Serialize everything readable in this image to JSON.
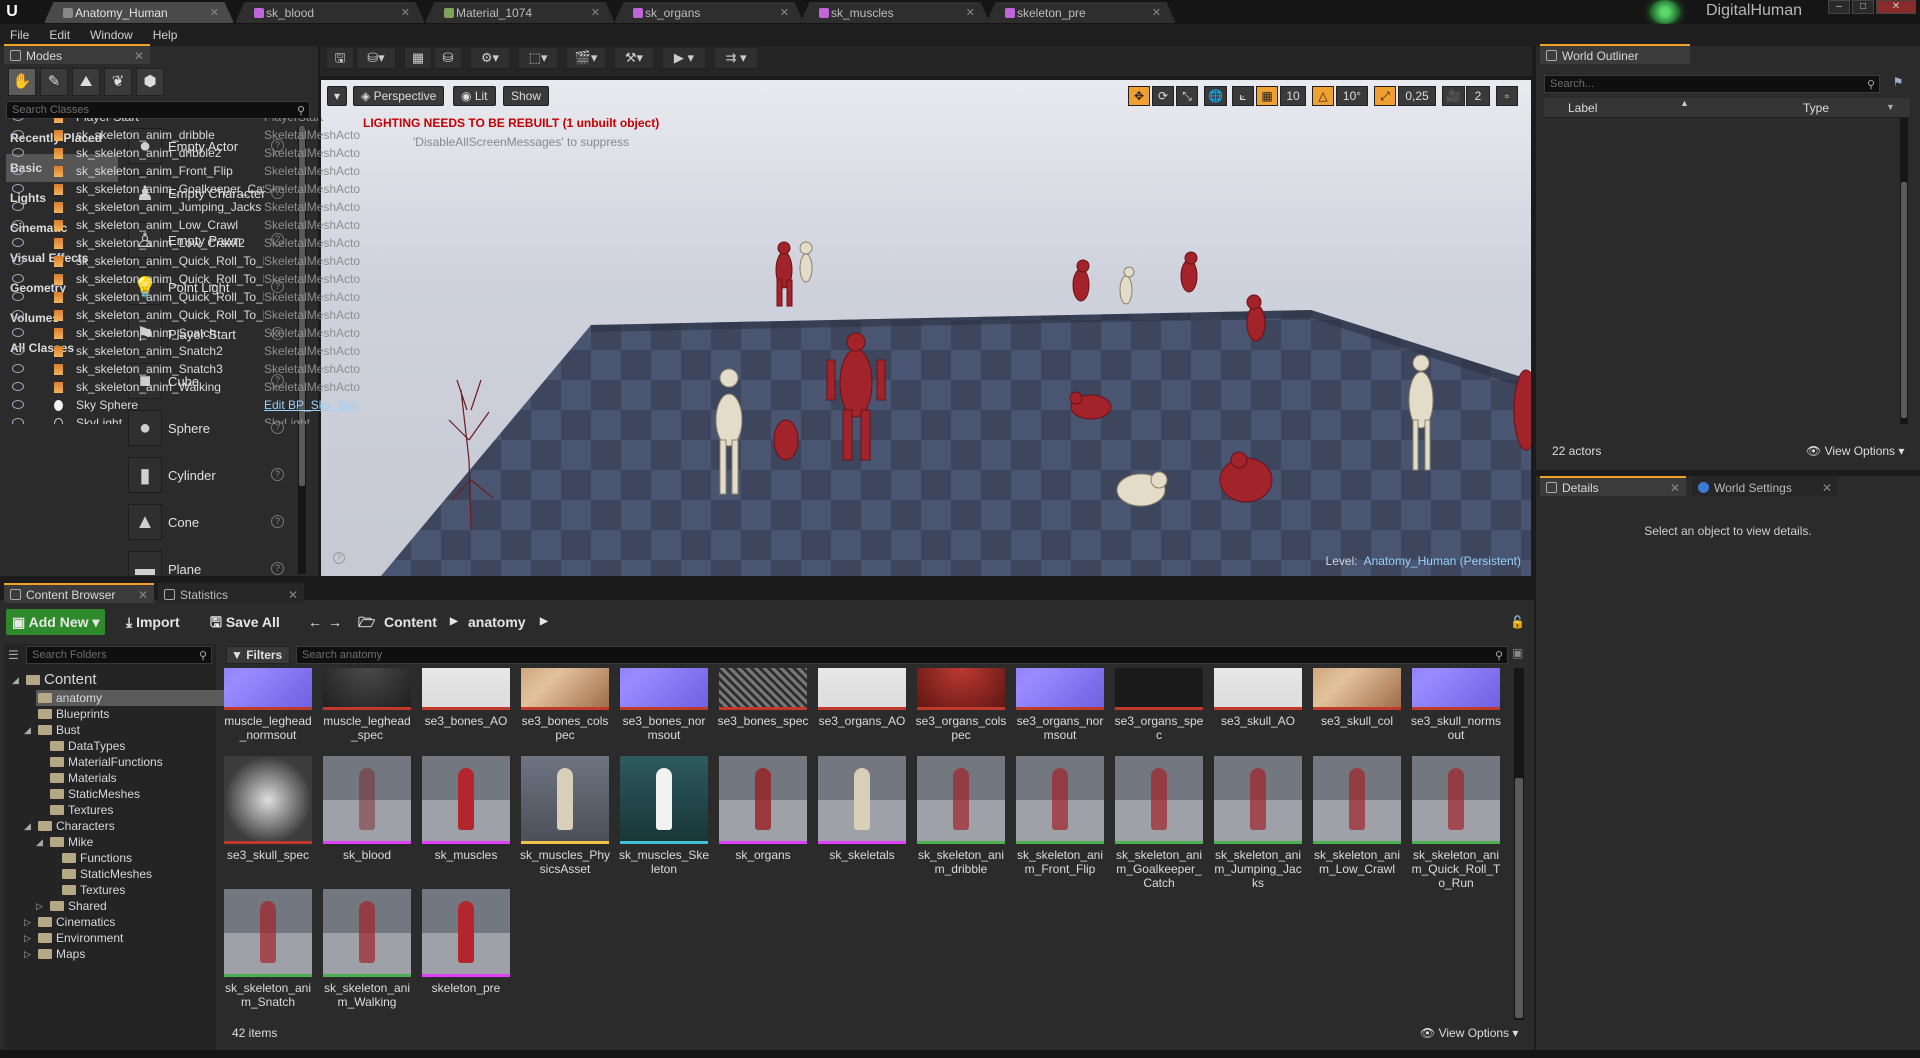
{
  "tabs": [
    {
      "label": "Anatomy_Human",
      "active": true,
      "icon": "level-icon"
    },
    {
      "label": "sk_blood",
      "active": false,
      "icon": "skeletal-mesh-icon"
    },
    {
      "label": "Material_1074",
      "active": false,
      "icon": "material-icon"
    },
    {
      "label": "sk_organs",
      "active": false,
      "icon": "skeletal-mesh-icon"
    },
    {
      "label": "sk_muscles",
      "active": false,
      "icon": "skeletal-mesh-icon"
    },
    {
      "label": "skeleton_pre",
      "active": false,
      "icon": "skeletal-mesh-icon"
    }
  ],
  "user": {
    "name": "DigitalHuman"
  },
  "menu": [
    "File",
    "Edit",
    "Window",
    "Help"
  ],
  "modes": {
    "tab": "Modes",
    "search_placeholder": "Search Classes",
    "categories": [
      "Recently Placed",
      "Basic",
      "Lights",
      "Cinematic",
      "Visual Effects",
      "Geometry",
      "Volumes",
      "All Classes"
    ],
    "active_category": "Basic",
    "items": [
      "Empty Actor",
      "Empty Character",
      "Empty Pawn",
      "Point Light",
      "Player Start",
      "Cube",
      "Sphere",
      "Cylinder",
      "Cone",
      "Plane"
    ]
  },
  "viewport": {
    "perspective": "Perspective",
    "lit": "Lit",
    "show": "Show",
    "grid_snap": "10",
    "rotation_snap": "10°",
    "scale_snap": "0,25",
    "camera_speed": "2",
    "warning": "LIGHTING NEEDS TO BE REBUILT (1 unbuilt object)",
    "suppress": "'DisableAllScreenMessages' to suppress",
    "level_label": "Level:",
    "level_name": "Anatomy_Human (Persistent)"
  },
  "outliner": {
    "tab": "World Outliner",
    "search_placeholder": "Search...",
    "col_label": "Label",
    "col_type": "Type",
    "rows": [
      {
        "label": "Player Start",
        "type": "PlayerStart"
      },
      {
        "label": "sk_skeleton_anim_dribble",
        "type": "SkeletalMeshActo"
      },
      {
        "label": "sk_skeleton_anim_dribble2",
        "type": "SkeletalMeshActo"
      },
      {
        "label": "sk_skeleton_anim_Front_Flip",
        "type": "SkeletalMeshActo"
      },
      {
        "label": "sk_skeleton_anim_Goalkeeper_Catc",
        "type": "SkeletalMeshActo"
      },
      {
        "label": "sk_skeleton_anim_Jumping_Jacks",
        "type": "SkeletalMeshActo"
      },
      {
        "label": "sk_skeleton_anim_Low_Crawl",
        "type": "SkeletalMeshActo"
      },
      {
        "label": "sk_skeleton_anim_Low_Crawl2",
        "type": "SkeletalMeshActo"
      },
      {
        "label": "sk_skeleton_anim_Quick_Roll_To_R",
        "type": "SkeletalMeshActo"
      },
      {
        "label": "sk_skeleton_anim_Quick_Roll_To_R",
        "type": "SkeletalMeshActo"
      },
      {
        "label": "sk_skeleton_anim_Quick_Roll_To_R",
        "type": "SkeletalMeshActo"
      },
      {
        "label": "sk_skeleton_anim_Quick_Roll_To_R",
        "type": "SkeletalMeshActo"
      },
      {
        "label": "sk_skeleton_anim_Snatch",
        "type": "SkeletalMeshActo"
      },
      {
        "label": "sk_skeleton_anim_Snatch2",
        "type": "SkeletalMeshActo"
      },
      {
        "label": "sk_skeleton_anim_Snatch3",
        "type": "SkeletalMeshActo"
      },
      {
        "label": "sk_skeleton_anim_Walking",
        "type": "SkeletalMeshActo"
      },
      {
        "label": "Sky Sphere",
        "type": "Edit BP_Sky_Sph"
      },
      {
        "label": "SkyLight",
        "type": "SkyLight"
      }
    ],
    "count": "22 actors",
    "view_options": "View Options"
  },
  "details": {
    "tab": "Details",
    "tab2": "World Settings",
    "empty": "Select an object to view details."
  },
  "content_browser": {
    "tab": "Content Browser",
    "tab2": "Statistics",
    "add_new": "Add New",
    "import": "Import",
    "save_all": "Save All",
    "path": [
      "Content",
      "anatomy"
    ],
    "folder_search": "Search Folders",
    "filters": "Filters",
    "asset_search": "Search anatomy",
    "item_count": "42 items",
    "view_options": "View Options",
    "folders": [
      {
        "label": "Content",
        "depth": 0,
        "expanded": true
      },
      {
        "label": "anatomy",
        "depth": 1,
        "selected": true
      },
      {
        "label": "Blueprints",
        "depth": 1
      },
      {
        "label": "Bust",
        "depth": 1,
        "expanded": true
      },
      {
        "label": "DataTypes",
        "depth": 2
      },
      {
        "label": "MaterialFunctions",
        "depth": 2
      },
      {
        "label": "Materials",
        "depth": 2
      },
      {
        "label": "StaticMeshes",
        "depth": 2
      },
      {
        "label": "Textures",
        "depth": 2
      },
      {
        "label": "Characters",
        "depth": 1,
        "expanded": true
      },
      {
        "label": "Mike",
        "depth": 2,
        "expanded": true
      },
      {
        "label": "Functions",
        "depth": 3
      },
      {
        "label": "StaticMeshes",
        "depth": 3
      },
      {
        "label": "Textures",
        "depth": 3
      },
      {
        "label": "Shared",
        "depth": 2,
        "collapsed": true
      },
      {
        "label": "Cinematics",
        "depth": 1,
        "collapsed": true
      },
      {
        "label": "Environment",
        "depth": 1,
        "collapsed": true
      },
      {
        "label": "Maps",
        "depth": 1,
        "collapsed": true
      }
    ],
    "assets_row1": [
      {
        "label": "muscle_leghead_normsout",
        "kind": "normal"
      },
      {
        "label": "muscle_leghead_spec",
        "kind": "dark"
      },
      {
        "label": "se3_bones_AO",
        "kind": "white"
      },
      {
        "label": "se3_bones_colspec",
        "kind": "tan"
      },
      {
        "label": "se3_bones_normsout",
        "kind": "normal"
      },
      {
        "label": "se3_bones_spec",
        "kind": "gray"
      },
      {
        "label": "se3_organs_AO",
        "kind": "white"
      },
      {
        "label": "se3_organs_colspec",
        "kind": "red"
      },
      {
        "label": "se3_organs_normsout",
        "kind": "normal"
      },
      {
        "label": "se3_organs_spec",
        "kind": "black"
      },
      {
        "label": "se3_skull_AO",
        "kind": "white"
      },
      {
        "label": "se3_skull_col",
        "kind": "tan"
      },
      {
        "label": "se3_skull_normsout",
        "kind": "normal"
      }
    ],
    "assets_row2": [
      {
        "label": "se3_skull_spec",
        "kind": "skull"
      },
      {
        "label": "sk_blood",
        "kind": "mesh-vein"
      },
      {
        "label": "sk_muscles",
        "kind": "mesh-muscle"
      },
      {
        "label": "sk_muscles_PhysicsAsset",
        "kind": "physics"
      },
      {
        "label": "sk_muscles_Skeleton",
        "kind": "skeleton"
      },
      {
        "label": "sk_organs",
        "kind": "mesh-organ"
      },
      {
        "label": "sk_skeletals",
        "kind": "mesh-bone"
      },
      {
        "label": "sk_skeleton_anim_dribble",
        "kind": "anim"
      },
      {
        "label": "sk_skeleton_anim_Front_Flip",
        "kind": "anim"
      },
      {
        "label": "sk_skeleton_anim_Goalkeeper_Catch",
        "kind": "anim"
      },
      {
        "label": "sk_skeleton_anim_Jumping_Jacks",
        "kind": "anim"
      },
      {
        "label": "sk_skeleton_anim_Low_Crawl",
        "kind": "anim"
      },
      {
        "label": "sk_skeleton_anim_Quick_Roll_To_Run",
        "kind": "anim"
      }
    ],
    "assets_row3": [
      {
        "label": "sk_skeleton_anim_Snatch",
        "kind": "anim"
      },
      {
        "label": "sk_skeleton_anim_Walking",
        "kind": "anim"
      },
      {
        "label": "skeleton_pre",
        "kind": "mesh-muscle"
      }
    ]
  },
  "colors": {
    "accent": "#f0a22a",
    "add_new": "#2f8a2b",
    "selected_folder": "#5a5a5a",
    "warning": "#c40000",
    "link": "#9ad0ff"
  }
}
